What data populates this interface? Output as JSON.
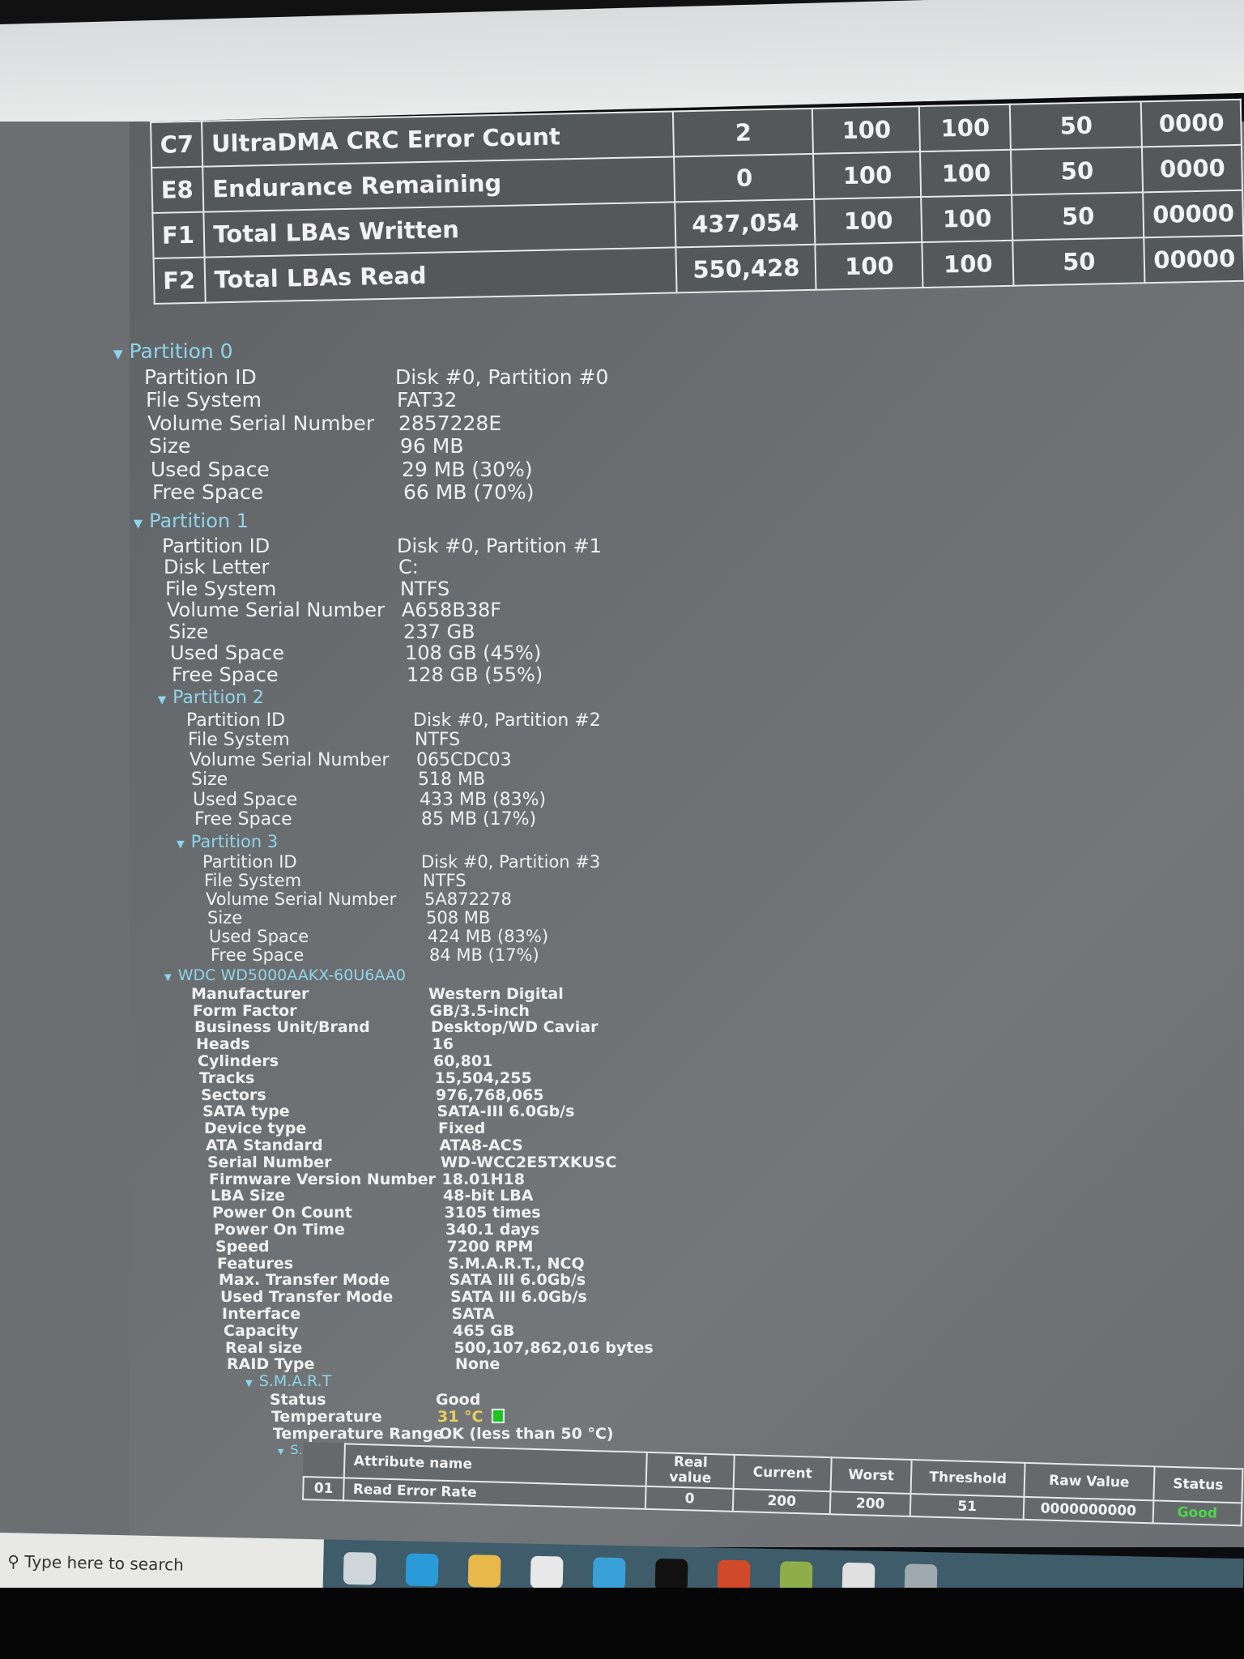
{
  "smart_table_top": {
    "rows": [
      {
        "id": "C7",
        "name": "UltraDMA CRC Error Count",
        "real": "2",
        "current": "100",
        "worst": "100",
        "threshold": "50",
        "raw": "0000"
      },
      {
        "id": "E8",
        "name": "Endurance Remaining",
        "real": "0",
        "current": "100",
        "worst": "100",
        "threshold": "50",
        "raw": "0000"
      },
      {
        "id": "F1",
        "name": "Total LBAs Written",
        "real": "437,054",
        "current": "100",
        "worst": "100",
        "threshold": "50",
        "raw": "00000"
      },
      {
        "id": "F2",
        "name": "Total LBAs Read",
        "real": "550,428",
        "current": "100",
        "worst": "100",
        "threshold": "50",
        "raw": "00000"
      }
    ]
  },
  "partitions": [
    {
      "title": "Partition 0",
      "rows": [
        [
          "Partition ID",
          "Disk #0, Partition #0"
        ],
        [
          "File System",
          "FAT32"
        ],
        [
          "Volume Serial Number",
          "2857228E"
        ],
        [
          "Size",
          "96 MB"
        ],
        [
          "Used Space",
          "29 MB (30%)"
        ],
        [
          "Free Space",
          "66 MB (70%)"
        ]
      ]
    },
    {
      "title": "Partition 1",
      "rows": [
        [
          "Partition ID",
          "Disk #0, Partition #1"
        ],
        [
          "Disk Letter",
          "C:"
        ],
        [
          "File System",
          "NTFS"
        ],
        [
          "Volume Serial Number",
          "A658B38F"
        ],
        [
          "Size",
          "237 GB"
        ],
        [
          "Used Space",
          "108 GB (45%)"
        ],
        [
          "Free Space",
          "128 GB (55%)"
        ]
      ]
    },
    {
      "title": "Partition 2",
      "rows": [
        [
          "Partition ID",
          "Disk #0, Partition #2"
        ],
        [
          "File System",
          "NTFS"
        ],
        [
          "Volume Serial Number",
          "065CDC03"
        ],
        [
          "Size",
          "518 MB"
        ],
        [
          "Used Space",
          "433 MB (83%)"
        ],
        [
          "Free Space",
          "85 MB (17%)"
        ]
      ]
    },
    {
      "title": "Partition 3",
      "rows": [
        [
          "Partition ID",
          "Disk #0, Partition #3"
        ],
        [
          "File System",
          "NTFS"
        ],
        [
          "Volume Serial Number",
          "5A872278"
        ],
        [
          "Size",
          "508 MB"
        ],
        [
          "Used Space",
          "424 MB (83%)"
        ],
        [
          "Free Space",
          "84 MB (17%)"
        ]
      ]
    }
  ],
  "drive": {
    "title": "WDC WD5000AAKX-60U6AA0",
    "rows": [
      [
        "Manufacturer",
        "Western Digital"
      ],
      [
        "Form Factor",
        "GB/3.5-inch"
      ],
      [
        "Business Unit/Brand",
        "Desktop/WD Caviar"
      ],
      [
        "Heads",
        "16"
      ],
      [
        "Cylinders",
        "60,801"
      ],
      [
        "Tracks",
        "15,504,255"
      ],
      [
        "Sectors",
        "976,768,065"
      ],
      [
        "SATA type",
        "SATA-III 6.0Gb/s"
      ],
      [
        "Device type",
        "Fixed"
      ],
      [
        "ATA Standard",
        "ATA8-ACS"
      ],
      [
        "Serial Number",
        "WD-WCC2E5TXKUSC"
      ],
      [
        "Firmware Version Number",
        "18.01H18"
      ],
      [
        "LBA Size",
        "48-bit LBA"
      ],
      [
        "Power On Count",
        "3105 times"
      ],
      [
        "Power On Time",
        "340.1 days"
      ],
      [
        "Speed",
        "7200 RPM"
      ],
      [
        "Features",
        "S.M.A.R.T., NCQ"
      ],
      [
        "Max. Transfer Mode",
        "SATA III 6.0Gb/s"
      ],
      [
        "Used Transfer Mode",
        "SATA III 6.0Gb/s"
      ],
      [
        "Interface",
        "SATA"
      ],
      [
        "Capacity",
        "465 GB"
      ],
      [
        "Real size",
        "500,107,862,016 bytes"
      ],
      [
        "RAID Type",
        "None"
      ]
    ]
  },
  "smart": {
    "title": "S.M.A.R.T",
    "status_label": "Status",
    "status": "Good",
    "temp_label": "Temperature",
    "temp": "31 °C",
    "range_label": "Temperature Range",
    "range": "OK (less than 50 °C)",
    "attributes_title": "S.M.A.R.T attributes",
    "headers": [
      "Attribute name",
      "Real value",
      "Current",
      "Worst",
      "Threshold",
      "Raw Value",
      "Status"
    ],
    "rows": [
      {
        "id": "01",
        "name": "Read Error Rate",
        "real": "0",
        "current": "200",
        "worst": "200",
        "threshold": "51",
        "raw": "0000000000",
        "status": "Good"
      }
    ]
  },
  "taskbar": {
    "search_placeholder": "Type here to search",
    "icons": [
      "task-view",
      "edge",
      "file-explorer",
      "microsoft-store",
      "mail",
      "tiktok",
      "powerpoint",
      "utorrent",
      "chrome",
      "speccy"
    ]
  },
  "colors": {
    "header": "#8fd4ea",
    "good": "#4cd64c",
    "temperature": "#e6d05a"
  }
}
